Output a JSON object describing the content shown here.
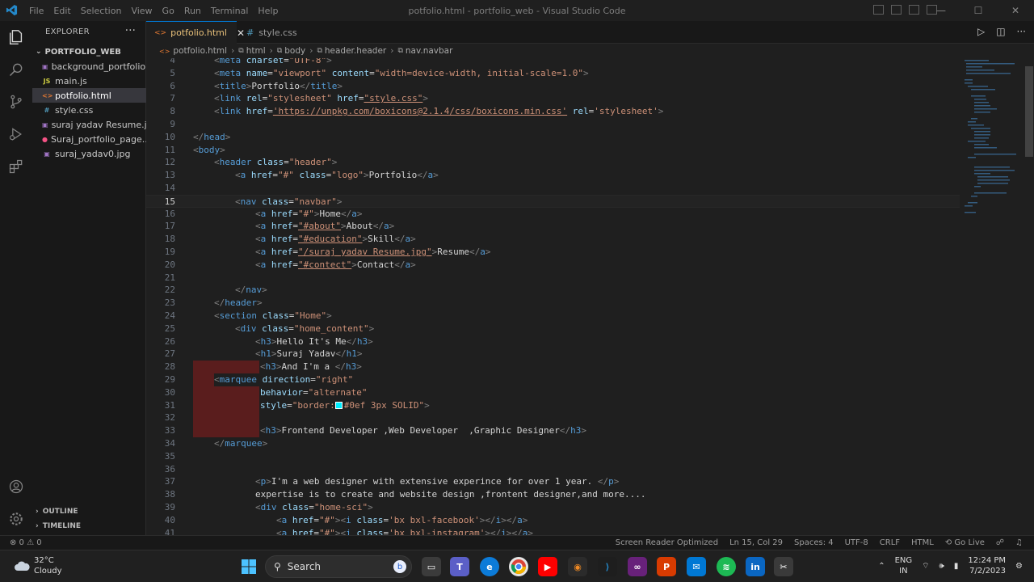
{
  "titlebar": {
    "menu": [
      "File",
      "Edit",
      "Selection",
      "View",
      "Go",
      "Run",
      "Terminal",
      "Help"
    ],
    "title": "potfolio.html - portfolio_web - Visual Studio Code"
  },
  "sidebar": {
    "header": "EXPLORER",
    "folder": "PORTFOLIO_WEB",
    "files": [
      {
        "name": "background_portfolio...",
        "icon": "image"
      },
      {
        "name": "main.js",
        "icon": "js"
      },
      {
        "name": "potfolio.html",
        "icon": "html"
      },
      {
        "name": "style.css",
        "icon": "css"
      },
      {
        "name": "suraj yadav Resume.jpg",
        "icon": "image"
      },
      {
        "name": "Suraj_portfolio_page...",
        "icon": "video"
      },
      {
        "name": "suraj_yadav0.jpg",
        "icon": "image"
      }
    ],
    "outline": "OUTLINE",
    "timeline": "TIMELINE"
  },
  "tabs": [
    {
      "label": "potfolio.html",
      "active": true
    },
    {
      "label": "style.css",
      "active": false
    }
  ],
  "breadcrumb": [
    "potfolio.html",
    "html",
    "body",
    "header.header",
    "nav.navbar"
  ],
  "editor": {
    "lines": [
      {
        "n": "4"
      },
      {
        "n": "5"
      },
      {
        "n": "6"
      },
      {
        "n": "7"
      },
      {
        "n": "8"
      },
      {
        "n": "9"
      },
      {
        "n": "10"
      },
      {
        "n": "11"
      },
      {
        "n": "12"
      },
      {
        "n": "13"
      },
      {
        "n": "14"
      },
      {
        "n": "15"
      },
      {
        "n": "16"
      },
      {
        "n": "17"
      },
      {
        "n": "18"
      },
      {
        "n": "19"
      },
      {
        "n": "20"
      },
      {
        "n": "21"
      },
      {
        "n": "22"
      },
      {
        "n": "23"
      },
      {
        "n": "24"
      },
      {
        "n": "25"
      },
      {
        "n": "26"
      },
      {
        "n": "27"
      },
      {
        "n": "28"
      },
      {
        "n": "29"
      },
      {
        "n": "30"
      },
      {
        "n": "31"
      },
      {
        "n": "32"
      },
      {
        "n": "33"
      },
      {
        "n": "34"
      },
      {
        "n": "35"
      },
      {
        "n": "36"
      },
      {
        "n": "37"
      },
      {
        "n": "38"
      },
      {
        "n": "39"
      },
      {
        "n": "40"
      },
      {
        "n": "41"
      }
    ],
    "text": {
      "l4a": "<",
      "l4b": "meta",
      "l4c": " charset",
      "l4d": "=",
      "l4e": "\"UTF-8\"",
      "l4f": ">",
      "l5b": "meta",
      "l5c": " name",
      "l5e": "\"viewport\"",
      "l5g": " content",
      "l5h": "\"width=device-width, initial-scale=1.0\"",
      "l6b": "title",
      "l6t": "Portfolio",
      "l7b": "link",
      "l7c": " rel",
      "l7e": "\"stylesheet\"",
      "l7g": " href",
      "l7h": "\"style.css\"",
      "l8b": "link",
      "l8c": " href",
      "l8e": "'https://unpkg.com/boxicons@2.1.4/css/boxicons.min.css'",
      "l8g": " rel",
      "l8h": "'stylesheet'",
      "l10b": "head",
      "l11b": "body",
      "l12b": "header",
      "l12c": " class",
      "l12e": "\"header\"",
      "l13b": "a",
      "l13c": " href",
      "l13e": "\"#\"",
      "l13g": " class",
      "l13h": "\"logo\"",
      "l13t": "Portfolio",
      "l15b": "nav",
      "l15c": " class",
      "l15e": "\"navbar\"",
      "l16e": "\"#\"",
      "l16t": "Home",
      "l17e": "\"#about\"",
      "l17t": "About",
      "l18e": "\"#education\"",
      "l18t": "Skill",
      "l19e": "\"/suraj yadav Resume.jpg\"",
      "l19t": "Resume",
      "l20e": "\"#contect\"",
      "l20t": "Contact",
      "l22b": "nav",
      "l23b": "header",
      "l24b": "section",
      "l24e": "\"Home\"",
      "l25b": "div",
      "l25e": "\"home_content\"",
      "l26b": "h3",
      "l26t": "Hello It's Me",
      "l27b": "h1",
      "l27t": "Suraj Yadav",
      "l28b": "h3",
      "l28t": "And I'm a ",
      "l29b": "marquee",
      "l29c": " direction",
      "l29e": "\"right\"",
      "l30c": "behavior",
      "l30e": "\"alternate\"",
      "l31c": "style",
      "l31e1": "\"border:",
      "l31e2": "#0ef 3px SOLID\"",
      "l33b": "h3",
      "l33t": "Frontend Developer ,Web Developer  ,Graphic Designer",
      "l34b": "marquee",
      "l37b": "p",
      "l37t": "I'm a web designer with extensive experince for over 1 year. ",
      "l38t": "expertise is to create and website design ,frontent designer,and more....",
      "l39b": "div",
      "l39e": "\"home-sci\"",
      "l40e": "\"#\"",
      "l40e2": "'bx bxl-facebook'",
      "l41e": "\"#\"",
      "l41e2": "'bx bxl-instagram'"
    }
  },
  "statusbar": {
    "problems": "⊗ 0 ⚠ 0",
    "items": [
      "Screen Reader Optimized",
      "Ln 15, Col 29",
      "Spaces: 4",
      "UTF-8",
      "CRLF",
      "HTML",
      "⟲ Go Live"
    ]
  },
  "taskbar": {
    "temp": "32°C",
    "condition": "Cloudy",
    "search": "Search",
    "lang1": "ENG",
    "lang2": "IN",
    "time": "12:24 PM",
    "date": "7/2/2023"
  },
  "colors": {
    "accent": "#0078d4",
    "tag": "#569cd6",
    "attr": "#9cdcfe",
    "string": "#ce9178"
  }
}
